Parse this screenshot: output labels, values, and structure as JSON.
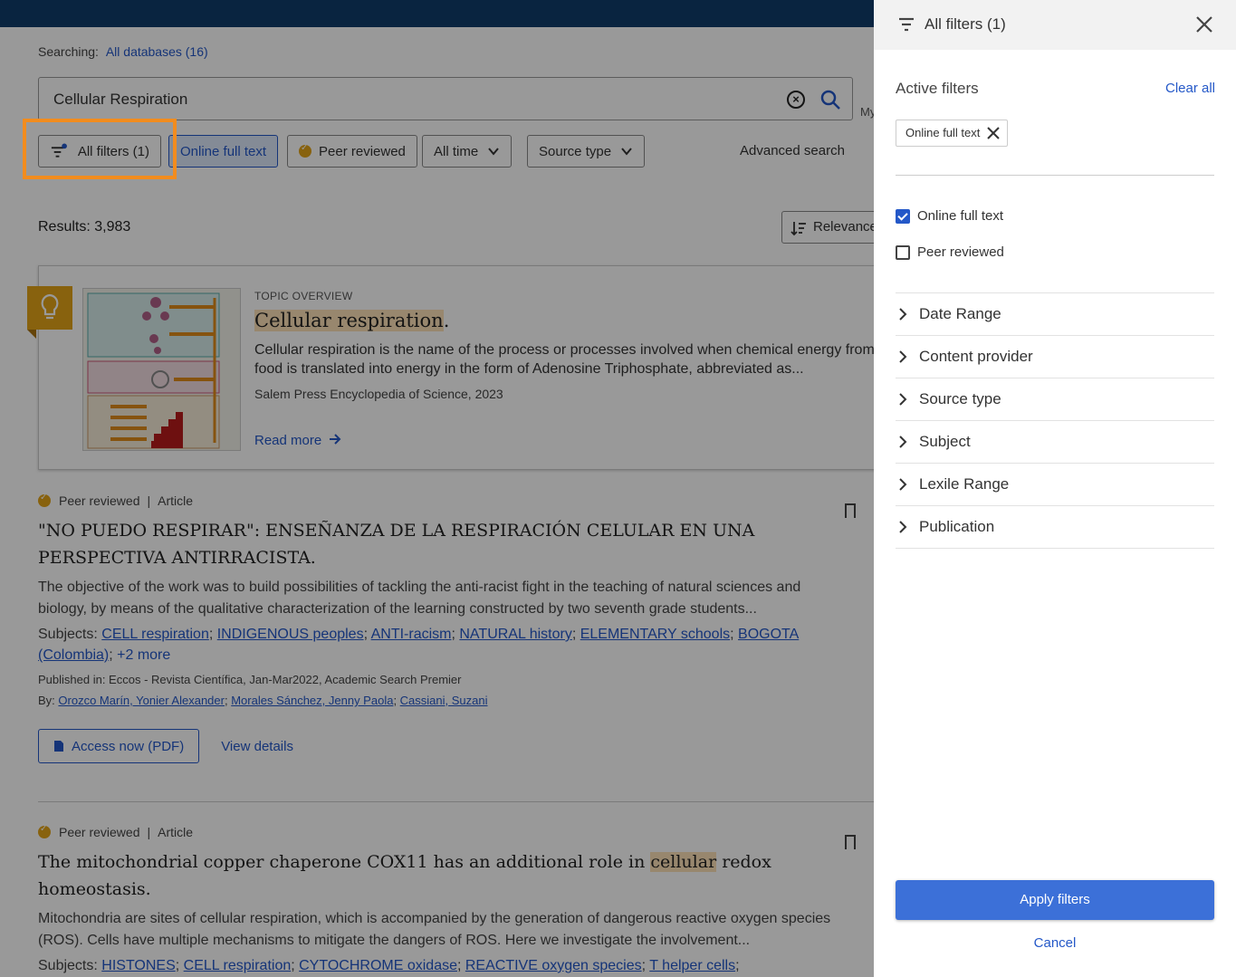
{
  "search": {
    "searching_label": "Searching:",
    "databases_link": "All databases (16)",
    "query": "Cellular Respiration",
    "my_label": "My"
  },
  "chips": {
    "all_filters": "All filters (1)",
    "online_full_text": "Online full text",
    "peer_reviewed": "Peer reviewed",
    "all_time": "All time",
    "source_type": "Source type",
    "advanced_search": "Advanced search"
  },
  "results": {
    "count_label": "Results: 3,983",
    "sort_label": "Relevance"
  },
  "topic": {
    "kicker": "TOPIC OVERVIEW",
    "title": "Cellular respiration",
    "title_suffix": ".",
    "description": "Cellular respiration is the name of the process or processes involved when chemical energy from food is translated into energy in the form of Adenosine Triphosphate, abbreviated as...",
    "source": "Salem Press Encyclopedia of Science, 2023",
    "read_more": "Read more"
  },
  "articles": [
    {
      "badge": "Peer reviewed",
      "type": "Article",
      "title": "\"NO PUEDO RESPIRAR\": ENSEÑANZA DE LA RESPIRACIÓN CELULAR EN UNA PERSPECTIVA ANTIRRACISTA.",
      "abstract": "The objective of the work was to build possibilities of tackling the anti-racist fight in the teaching of natural sciences and biology, by means of the qualitative characterization of the learning constructed by two seventh grade students...",
      "subjects_label": "Subjects:",
      "subjects": [
        "CELL respiration",
        "INDIGENOUS peoples",
        "ANTI-racism",
        "NATURAL history",
        "ELEMENTARY schools",
        "BOGOTA (Colombia)",
        "+2 more"
      ],
      "published": "Published in: Eccos - Revista Científica, Jan-Mar2022, Academic Search Premier",
      "by_label": "By:",
      "authors": [
        "Orozco Marín, Yonier Alexander",
        "Morales Sánchez, Jenny Paola",
        "Cassiani, Suzani"
      ],
      "access_label": "Access now (PDF)",
      "details_label": "View details"
    },
    {
      "badge": "Peer reviewed",
      "type": "Article",
      "title_before": "The mitochondrial copper chaperone COX11 has an additional role in ",
      "title_hl": "cellular",
      "title_after": " redox homeostasis.",
      "abstract": "Mitochondria are sites of cellular respiration, which is accompanied by the generation of dangerous reactive oxygen species (ROS). Cells have multiple mechanisms to mitigate the dangers of ROS. Here we investigate the involvement...",
      "subjects_label": "Subjects:",
      "subjects": [
        "HISTONES",
        "CELL respiration",
        "CYTOCHROME oxidase",
        "REACTIVE oxygen species",
        "T helper cells"
      ]
    }
  ],
  "drawer": {
    "title": "All filters (1)",
    "active_label": "Active filters",
    "clear_all": "Clear all",
    "active_chip": "Online full text",
    "checkboxes": [
      {
        "label": "Online full text",
        "checked": true
      },
      {
        "label": "Peer reviewed",
        "checked": false
      }
    ],
    "sections": [
      "Date Range",
      "Content provider",
      "Source type",
      "Subject",
      "Lexile Range",
      "Publication"
    ],
    "apply": "Apply filters",
    "cancel": "Cancel"
  },
  "colors": {
    "accent": "#2458c8",
    "topbar": "#0f3c6b",
    "badge": "#e3a318",
    "highlight": "#f28c1e",
    "apply_button": "#3c70d8"
  }
}
